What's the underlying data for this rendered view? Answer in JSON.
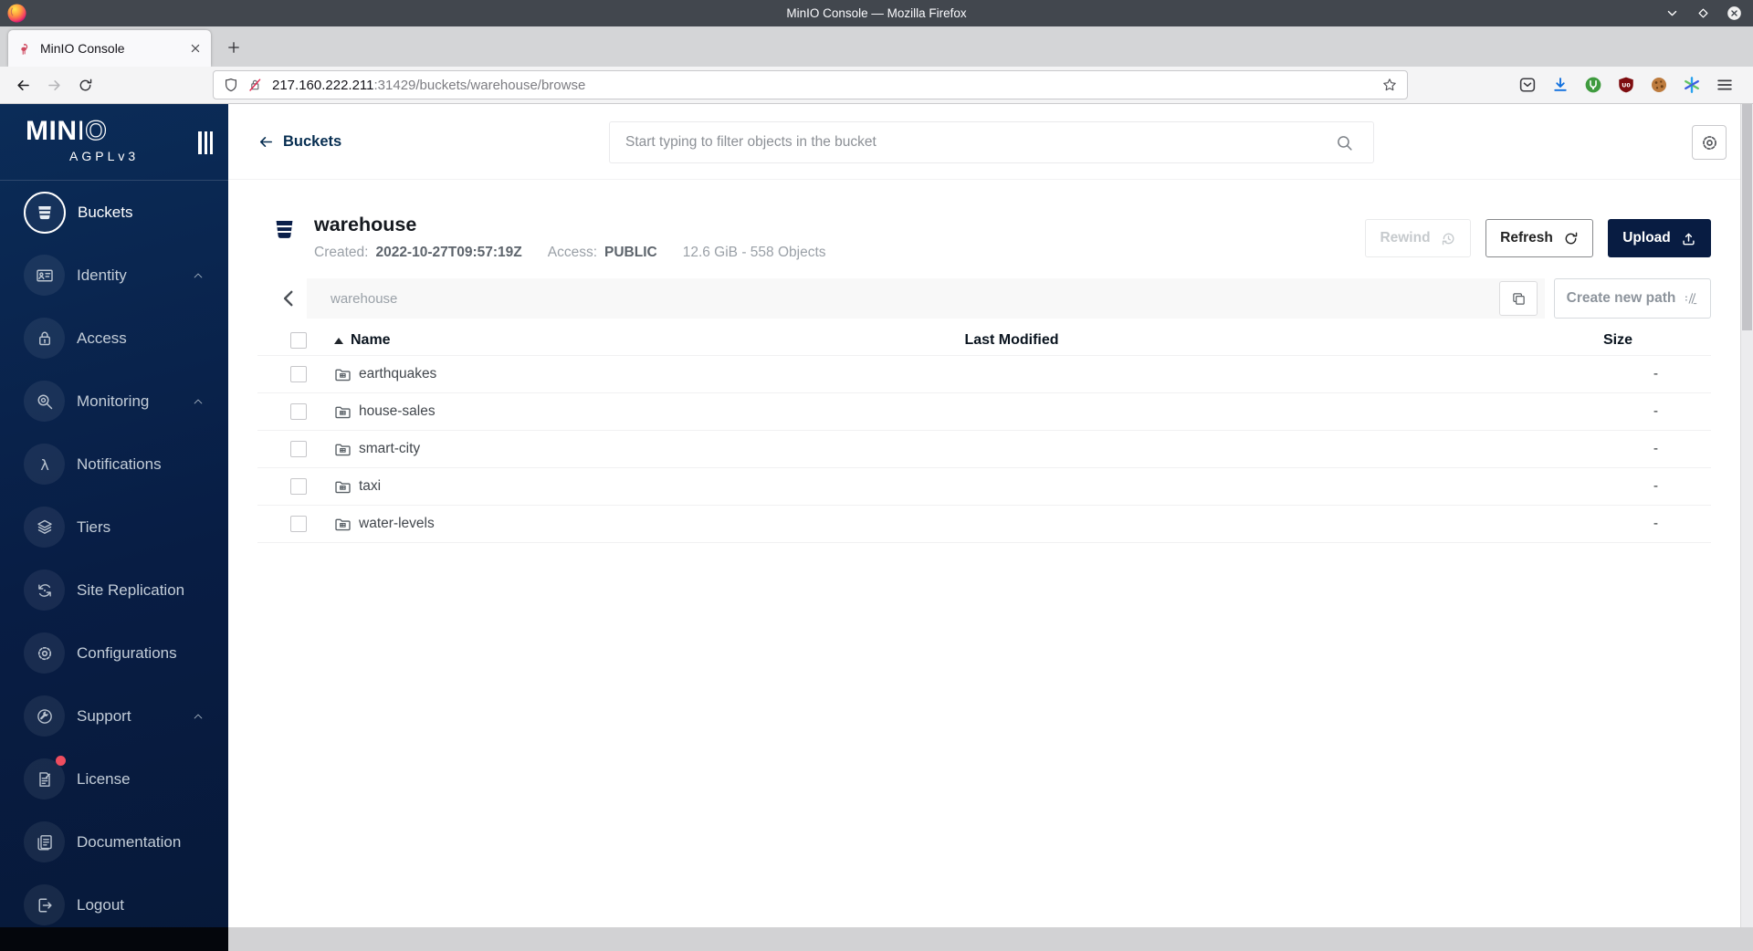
{
  "window": {
    "title": "MinIO Console — Mozilla Firefox",
    "controls": [
      "minimize",
      "maximize",
      "close"
    ]
  },
  "browser": {
    "tab_title": "MinIO Console",
    "url_host": "217.160.222.211",
    "url_rest": ":31429/buckets/warehouse/browse",
    "toolbar_icons": [
      "pocket",
      "downloads",
      "privacy-extension",
      "adblock-shield",
      "cookie-extension",
      "multicolor-extension",
      "app-menu"
    ]
  },
  "sidebar": {
    "logo_solid": "MIN",
    "logo_thin": "I",
    "logo_outline": "O",
    "license": "AGPLv3",
    "items": [
      {
        "label": "Buckets",
        "icon": "bucket",
        "active": true
      },
      {
        "label": "Identity",
        "icon": "identity",
        "chevron": true
      },
      {
        "label": "Access",
        "icon": "access"
      },
      {
        "label": "Monitoring",
        "icon": "monitoring",
        "chevron": true
      },
      {
        "label": "Notifications",
        "icon": "lambda"
      },
      {
        "label": "Tiers",
        "icon": "tiers"
      },
      {
        "label": "Site Replication",
        "icon": "replication"
      },
      {
        "label": "Configurations",
        "icon": "gear"
      },
      {
        "label": "Support",
        "icon": "support",
        "chevron": true
      },
      {
        "label": "License",
        "icon": "license",
        "badge": true
      },
      {
        "label": "Documentation",
        "icon": "documentation"
      },
      {
        "label": "Logout",
        "icon": "logout"
      }
    ]
  },
  "header": {
    "back_label": "Buckets",
    "search_placeholder": "Start typing to filter objects in the bucket"
  },
  "bucket": {
    "name": "warehouse",
    "created_label": "Created:",
    "created_value": "2022-10-27T09:57:19Z",
    "access_label": "Access:",
    "access_value": "PUBLIC",
    "usage": "12.6 GiB - 558 Objects",
    "rewind_label": "Rewind",
    "refresh_label": "Refresh",
    "upload_label": "Upload"
  },
  "pathbar": {
    "current_path": "warehouse",
    "create_path_label": "Create new path"
  },
  "objects_table": {
    "columns": {
      "name": "Name",
      "last_modified": "Last Modified",
      "size": "Size"
    },
    "rows": [
      {
        "name": "earthquakes",
        "last_modified": "",
        "size": "-"
      },
      {
        "name": "house-sales",
        "last_modified": "",
        "size": "-"
      },
      {
        "name": "smart-city",
        "last_modified": "",
        "size": "-"
      },
      {
        "name": "taxi",
        "last_modified": "",
        "size": "-"
      },
      {
        "name": "water-levels",
        "last_modified": "",
        "size": "-"
      }
    ]
  },
  "colors": {
    "sidebar_navy": "#081c42",
    "upload_navy": "#081c42",
    "badge_red": "#ee4d5f",
    "titlebar_grey": "#42474e"
  }
}
